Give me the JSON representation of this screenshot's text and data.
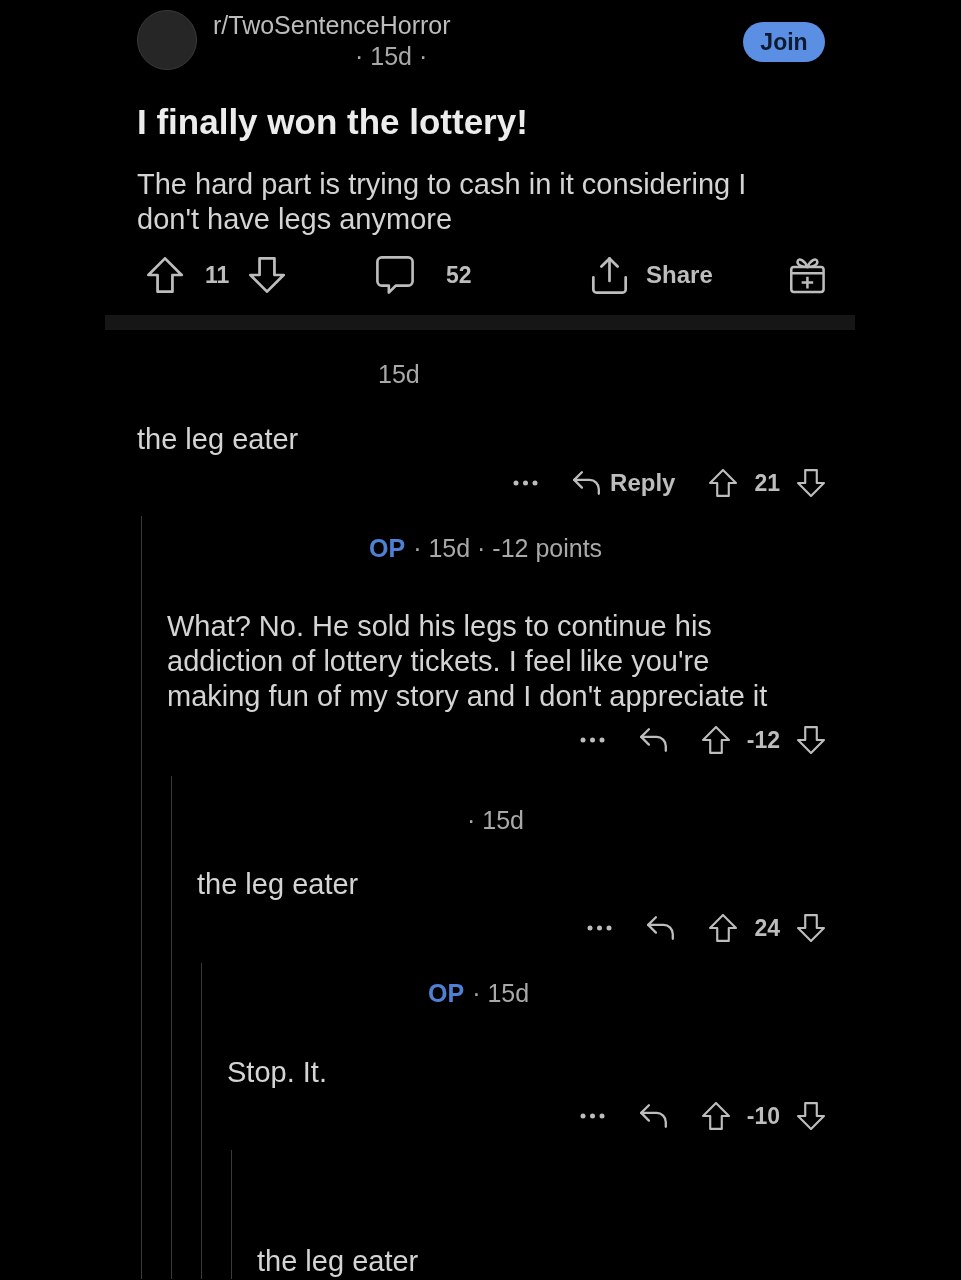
{
  "post": {
    "subreddit": "r/TwoSentenceHorror",
    "meta": "· 15d ·",
    "join_label": "Join",
    "title": "I finally won the lottery!",
    "body": "The hard part is trying to cash in it considering I don't have legs anymore",
    "score": "11",
    "comment_count": "52",
    "share_label": "Share"
  },
  "comments": [
    {
      "meta": "15d",
      "body": "the leg eater",
      "reply_label": "Reply",
      "score": "21",
      "children": [
        {
          "author": "OP",
          "meta": "· 15d · -12 points",
          "body": "What? No. He sold his legs to continue his addiction of lottery tickets. I feel like you're making fun of my story and I don't appreciate it",
          "score": "-12",
          "children": [
            {
              "meta": "· 15d",
              "body": "the leg eater",
              "score": "24",
              "children": [
                {
                  "author": "OP",
                  "meta": "· 15d",
                  "body": "Stop. It.",
                  "score": "-10",
                  "children": [
                    {
                      "body": "the leg eater"
                    }
                  ]
                }
              ]
            }
          ]
        }
      ]
    }
  ]
}
